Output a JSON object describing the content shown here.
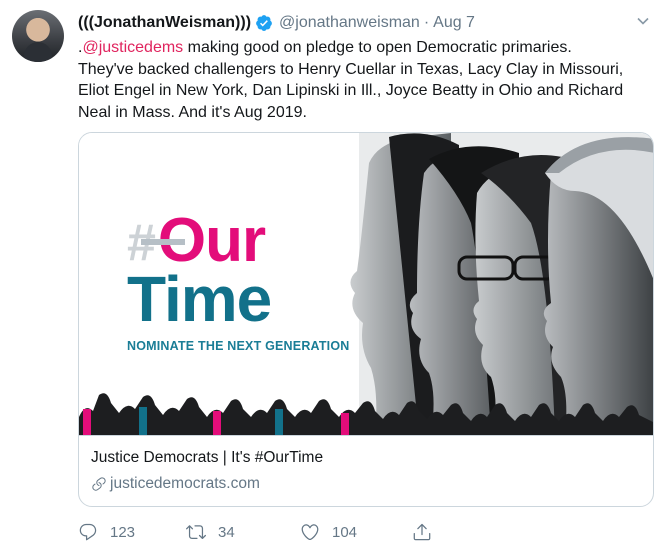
{
  "author": {
    "display_name": "(((JonathanWeisman)))",
    "handle": "@jonathanweisman",
    "separator": "·",
    "date": "Aug 7",
    "verified": true
  },
  "tweet": {
    "lines": [
      {
        "prefix": ".",
        "mention": "@justicedems",
        "rest": " making good on pledge to open Democratic primaries."
      },
      {
        "text": "They've backed challengers to Henry Cuellar in Texas, Lacy Clay in Missouri,"
      },
      {
        "text": "Eliot Engel in New York, Dan Lipinski in Ill., Joyce Beatty in Ohio and Richard"
      },
      {
        "text": "Neal in Mass. And it's Aug 2019."
      }
    ]
  },
  "card": {
    "image_hash": "#",
    "image_our": "Our",
    "image_time": "Time",
    "image_tagline": "NOMINATE THE NEXT GENERATION",
    "title": "Justice Democrats | It's #OurTime",
    "url": "justicedemocrats.com"
  },
  "actions": {
    "reply_count": "123",
    "retweet_count": "34",
    "like_count": "104"
  },
  "colors": {
    "mention": "#e0245e",
    "secondary_text": "#657786",
    "verified_blue": "#1da1f2",
    "brand_magenta": "#e30d7a",
    "brand_teal": "#12718a"
  },
  "icons": {
    "caret": "chevron-down-icon",
    "verified": "verified-badge-icon",
    "link": "link-icon",
    "reply": "reply-icon",
    "retweet": "retweet-icon",
    "like": "heart-icon",
    "share": "share-icon"
  }
}
